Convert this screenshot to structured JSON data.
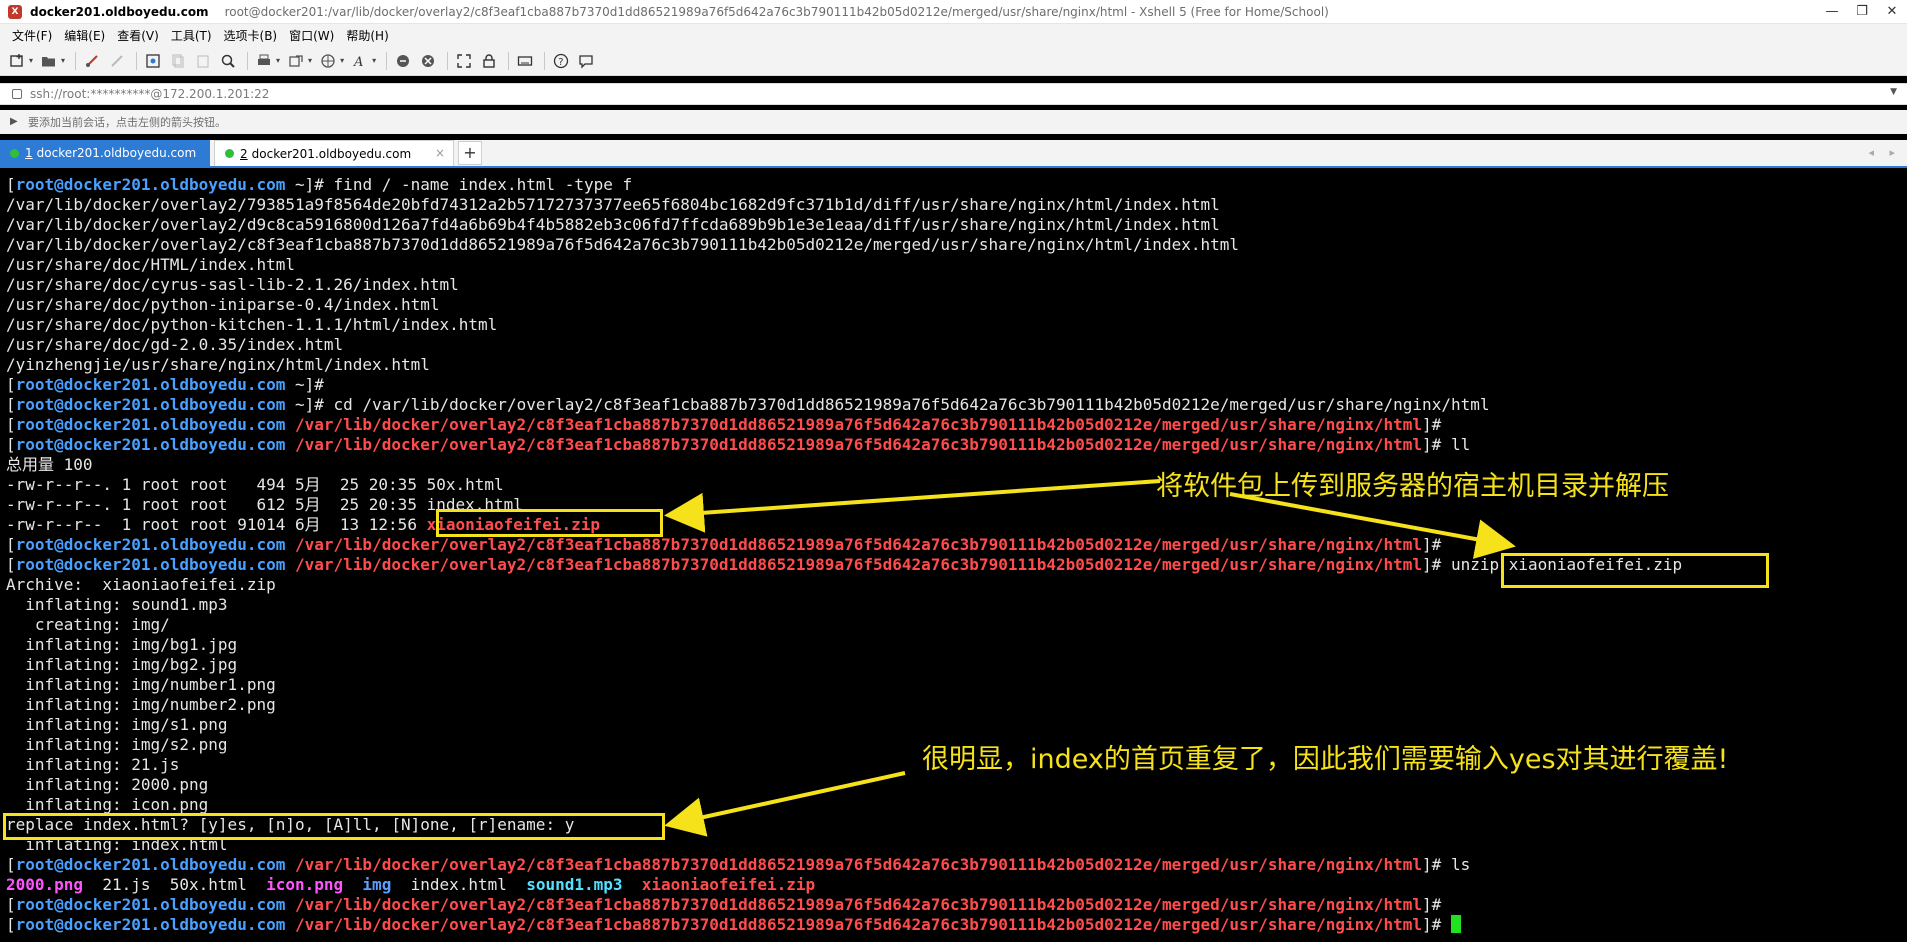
{
  "window": {
    "app_icon": "xshell-icon",
    "title_host": "docker201.oldboyedu.com",
    "title_full": "root@docker201:/var/lib/docker/overlay2/c8f3eaf1cba887b7370d1dd86521989a76f5d642a76c3b790111b42b05d0212e/merged/usr/share/nginx/html - Xshell 5 (Free for Home/School)",
    "controls": {
      "minimize": "—",
      "maximize": "❐",
      "close": "✕"
    }
  },
  "menu": [
    "文件(F)",
    "编辑(E)",
    "查看(V)",
    "工具(T)",
    "选项卡(B)",
    "窗口(W)",
    "帮助(H)"
  ],
  "toolbar_icons": [
    "new-session-icon",
    "open-folder-icon",
    "connect-icon",
    "disconnect-icon",
    "properties-icon",
    "copy-icon",
    "paste-icon",
    "find-icon",
    "print-icon",
    "transfer-icon",
    "globe-icon",
    "font-icon",
    "xftp-icon",
    "xmanager-icon",
    "fullscreen-icon",
    "lock-icon",
    "keyboard-icon",
    "help-icon",
    "chat-icon"
  ],
  "address": {
    "text": "ssh://root:**********@172.200.1.201:22"
  },
  "hint": {
    "text": "要添加当前会话，点击左侧的箭头按钮。"
  },
  "tabs": [
    {
      "num": "1",
      "label": "docker201.oldboyedu.com",
      "active": true
    },
    {
      "num": "2",
      "label": "docker201.oldboyedu.com",
      "active": false
    }
  ],
  "tab_add": "+",
  "tab_nav": "◂ ▸",
  "terminal": {
    "prompt_user": "[root@docker201.oldboyedu.com",
    "home": "~",
    "cwd": "/var/lib/docker/overlay2/c8f3eaf1cba887b7370d1dd86521989a76f5d642a76c3b790111b42b05d0212e/merged/usr/share/nginx/html",
    "lines": [
      {
        "kind": "home",
        "cmd": "find / -name index.html -type f"
      },
      {
        "kind": "out",
        "text": "/var/lib/docker/overlay2/793851a9f8564de20bfd74312a2b57172737377ee65f6804bc1682d9fc371b1d/diff/usr/share/nginx/html/index.html"
      },
      {
        "kind": "out",
        "text": "/var/lib/docker/overlay2/d9c8ca5916800d126a7fd4a6b69b4f4b5882eb3c06fd7ffcda689b9b1e3e1eaa/diff/usr/share/nginx/html/index.html"
      },
      {
        "kind": "out",
        "text": "/var/lib/docker/overlay2/c8f3eaf1cba887b7370d1dd86521989a76f5d642a76c3b790111b42b05d0212e/merged/usr/share/nginx/html/index.html"
      },
      {
        "kind": "out",
        "text": "/usr/share/doc/HTML/index.html"
      },
      {
        "kind": "out",
        "text": "/usr/share/doc/cyrus-sasl-lib-2.1.26/index.html"
      },
      {
        "kind": "out",
        "text": "/usr/share/doc/python-iniparse-0.4/index.html"
      },
      {
        "kind": "out",
        "text": "/usr/share/doc/python-kitchen-1.1.1/html/index.html"
      },
      {
        "kind": "out",
        "text": "/usr/share/doc/gd-2.0.35/index.html"
      },
      {
        "kind": "out",
        "text": "/yinzhengjie/usr/share/nginx/html/index.html"
      },
      {
        "kind": "home",
        "cmd": ""
      },
      {
        "kind": "home",
        "cmd": "cd /var/lib/docker/overlay2/c8f3eaf1cba887b7370d1dd86521989a76f5d642a76c3b790111b42b05d0212e/merged/usr/share/nginx/html"
      },
      {
        "kind": "cwd",
        "cmd": ""
      },
      {
        "kind": "cwd",
        "cmd": "ll"
      },
      {
        "kind": "out",
        "text": "总用量 100"
      },
      {
        "kind": "out",
        "text": "-rw-r--r--. 1 root root   494 5月  25 20:35 50x.html"
      },
      {
        "kind": "out",
        "text": "-rw-r--r--. 1 root root   612 5月  25 20:35 index.html"
      },
      {
        "kind": "file",
        "text": "-rw-r--r--  1 root root 91014 6月  13 12:56 ",
        "file": "xiaoniaofeifei.zip"
      },
      {
        "kind": "cwd",
        "cmd": ""
      },
      {
        "kind": "cwd",
        "cmd": "unzip xiaoniaofeifei.zip"
      },
      {
        "kind": "out",
        "text": "Archive:  xiaoniaofeifei.zip"
      },
      {
        "kind": "out",
        "text": "  inflating: sound1.mp3"
      },
      {
        "kind": "out",
        "text": "   creating: img/"
      },
      {
        "kind": "out",
        "text": "  inflating: img/bg1.jpg"
      },
      {
        "kind": "out",
        "text": "  inflating: img/bg2.jpg"
      },
      {
        "kind": "out",
        "text": "  inflating: img/number1.png"
      },
      {
        "kind": "out",
        "text": "  inflating: img/number2.png"
      },
      {
        "kind": "out",
        "text": "  inflating: img/s1.png"
      },
      {
        "kind": "out",
        "text": "  inflating: img/s2.png"
      },
      {
        "kind": "out",
        "text": "  inflating: 21.js"
      },
      {
        "kind": "out",
        "text": "  inflating: 2000.png"
      },
      {
        "kind": "out",
        "text": "  inflating: icon.png"
      },
      {
        "kind": "out",
        "text": "replace index.html? [y]es, [n]o, [A]ll, [N]one, [r]ename: y"
      },
      {
        "kind": "out",
        "text": "  inflating: index.html"
      },
      {
        "kind": "cwd",
        "cmd": "ls"
      },
      {
        "kind": "ls",
        "items": [
          {
            "name": "2000.png",
            "color": "magenta"
          },
          {
            "name": "21.js",
            "color": "plain"
          },
          {
            "name": "50x.html",
            "color": "plain"
          },
          {
            "name": "icon.png",
            "color": "magenta"
          },
          {
            "name": "img",
            "color": "blue"
          },
          {
            "name": "index.html",
            "color": "plain"
          },
          {
            "name": "sound1.mp3",
            "color": "cyan"
          },
          {
            "name": "xiaoniaofeifei.zip",
            "color": "red"
          }
        ]
      },
      {
        "kind": "cwd",
        "cmd": ""
      },
      {
        "kind": "cwd",
        "cmd": "",
        "cursor": true
      }
    ]
  },
  "annotations": {
    "upload_note": "将软件包上传到服务器的宿主机目录并解压",
    "replace_note": "很明显，index的首页重复了，因此我们需要输入yes对其进行覆盖!",
    "color": "#f5e21a"
  }
}
